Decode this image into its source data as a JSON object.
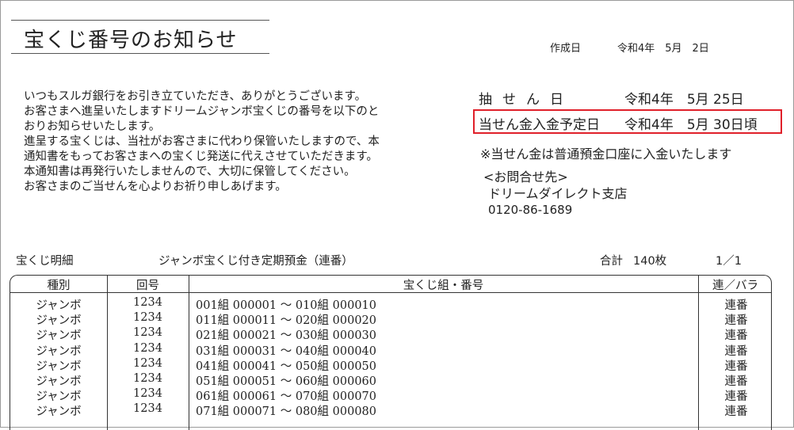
{
  "document": {
    "title": "宝くじ番号のお知らせ",
    "created_label": "作成日",
    "created_date": "令和4年　5月　2日"
  },
  "intro_lines": [
    "いつもスルガ銀行をお引き立ていただき、ありがとうございます。",
    "お客さまへ進呈いたしますドリームジャンボ宝くじの番号を以下のと",
    "おりお知らせいたします。",
    "進呈する宝くじは、当社がお客さまに代わり保管いたしますので、本",
    "通知書をもってお客さまへの宝くじ発送に代えさせていただきます。",
    "本通知書は再発行いたしませんので、大切に保管してください。",
    "お客さまのご当せんを心よりお祈り申しあげます。"
  ],
  "draw": {
    "label": "抽せん日",
    "date": "令和4年　5月 25日"
  },
  "payout": {
    "label": "当せん金入金予定日",
    "date": "令和4年　5月 30日頃"
  },
  "note": "※当せん金は普通預金口座に入金いたします",
  "contact": {
    "heading": "<お問合せ先>",
    "branch": "ドリームダイレクト支店",
    "phone": "0120-86-1689"
  },
  "statement": {
    "title": "宝くじ明細",
    "product": "ジャンボ宝くじ付き定期預金（連番）",
    "total_label": "合計",
    "total_value": "140枚",
    "page": "1／1"
  },
  "table": {
    "headers": {
      "type": "種別",
      "number": "回号",
      "range": "宝くじ組・番号",
      "kind": "連／バラ"
    },
    "rows": [
      {
        "type": "ジャンボ",
        "number": "1234",
        "range": "001組 000001 ～ 010組 000010",
        "kind": "連番"
      },
      {
        "type": "ジャンボ",
        "number": "1234",
        "range": "011組 000011 ～ 020組 000020",
        "kind": "連番"
      },
      {
        "type": "ジャンボ",
        "number": "1234",
        "range": "021組 000021 ～ 030組 000030",
        "kind": "連番"
      },
      {
        "type": "ジャンボ",
        "number": "1234",
        "range": "031組 000031 ～ 040組 000040",
        "kind": "連番"
      },
      {
        "type": "ジャンボ",
        "number": "1234",
        "range": "041組 000041 ～ 050組 000050",
        "kind": "連番"
      },
      {
        "type": "ジャンボ",
        "number": "1234",
        "range": "051組 000051 ～ 060組 000060",
        "kind": "連番"
      },
      {
        "type": "ジャンボ",
        "number": "1234",
        "range": "061組 000061 ～ 070組 000070",
        "kind": "連番"
      },
      {
        "type": "ジャンボ",
        "number": "1234",
        "range": "071組 000071 ～ 080組 000080",
        "kind": "連番"
      }
    ]
  },
  "colors": {
    "highlight_border": "#e0202a",
    "rule": "#333333"
  }
}
